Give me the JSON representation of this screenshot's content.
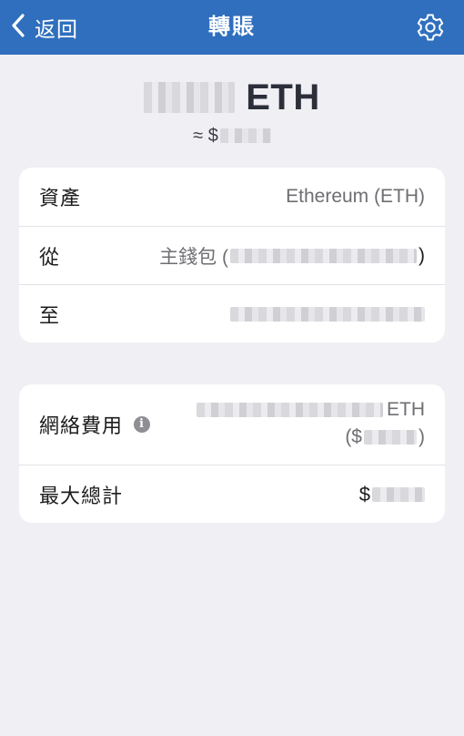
{
  "nav": {
    "back_label": "返回",
    "title": "轉賬",
    "back_icon": "chevron-left-icon",
    "settings_icon": "gear-icon"
  },
  "amount": {
    "currency": "ETH",
    "approx_prefix": "≈ $"
  },
  "details": {
    "asset_label": "資產",
    "asset_value": "Ethereum (ETH)",
    "from_label": "從",
    "from_value_prefix": "主錢包 (",
    "from_value_suffix": ")",
    "to_label": "至"
  },
  "fees": {
    "network_fee_label": "網絡費用",
    "network_fee_currency": "ETH",
    "network_fee_fiat_prefix": "($",
    "network_fee_fiat_suffix": ")",
    "info_icon": "info-icon",
    "max_total_label": "最大總計",
    "max_total_prefix": "$"
  },
  "colors": {
    "nav_bar": "#2f6fbe",
    "background": "#f0eff4",
    "card": "#ffffff"
  }
}
